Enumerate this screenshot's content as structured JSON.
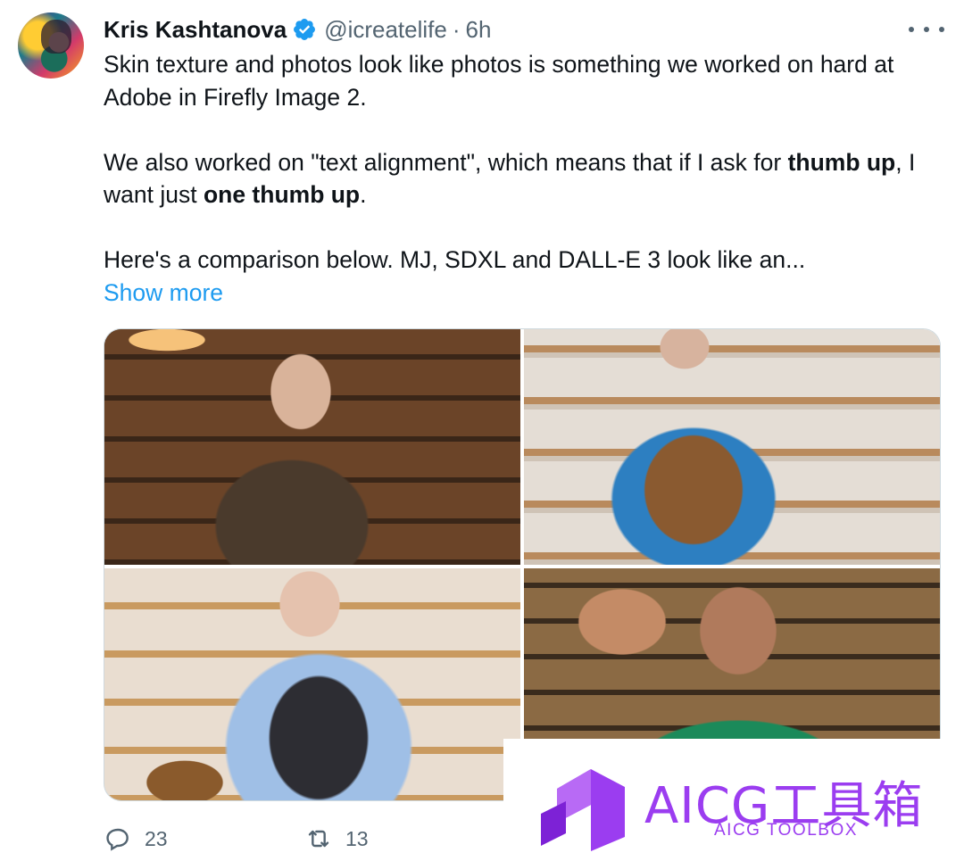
{
  "author": {
    "name": "Kris Kashtanova",
    "handle": "@icreatelife",
    "separator": "·",
    "time": "6h",
    "verified_color": "#1d9bf0"
  },
  "tweet": {
    "p1": "Skin texture and photos look like photos is something we worked on hard at Adobe in Firefly Image 2.",
    "p2_a": "We also worked on \"text alignment\", which means that if I ask for ",
    "p2_b": "thumb up",
    "p2_c": ", I want just ",
    "p2_d": "one thumb up",
    "p2_e": ".",
    "p3": "Here's a comparison below. MJ, SDXL and DALL-E 3 look like an...",
    "show_more": "Show more",
    "link_color": "#1d9bf0"
  },
  "media": {
    "images": [
      "baker-thumbs-up-1",
      "baker-thumbs-up-2",
      "baker-thumbs-up-3",
      "baker-thumbs-up-4"
    ]
  },
  "actions": {
    "replies": "23",
    "retweets": "13"
  },
  "watermark": {
    "title": "AICG工具箱",
    "subtitle": "AICG TOOLBOX",
    "color": "#9b3df0"
  }
}
